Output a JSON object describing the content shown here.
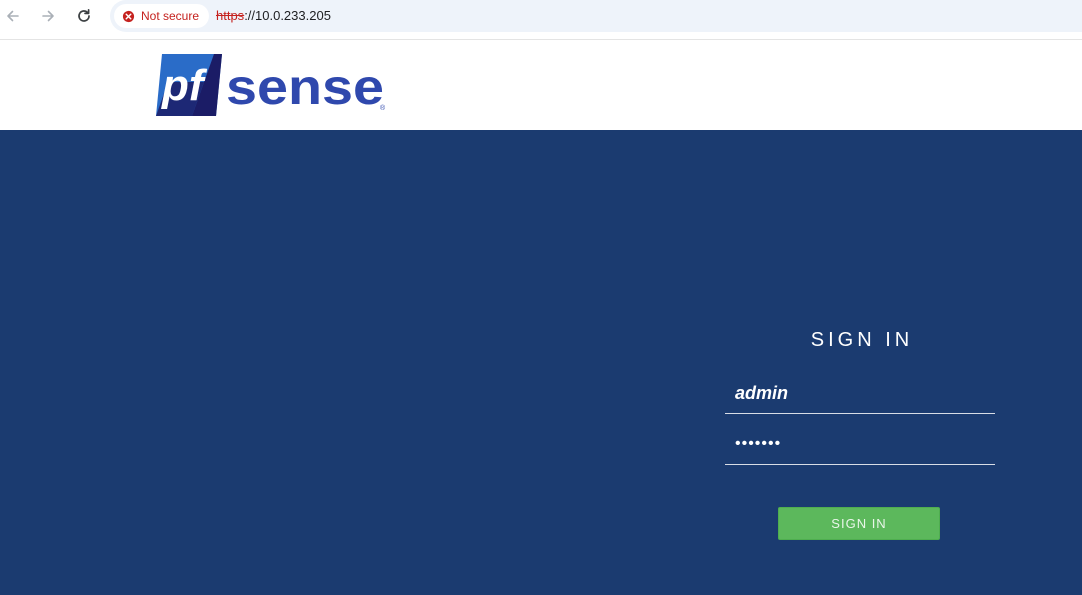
{
  "browser": {
    "security_label": "Not secure",
    "url_scheme": "https",
    "url_rest": "://10.0.233.205"
  },
  "logo": {
    "text_pf": "pf",
    "text_sense": "sense",
    "registered": "®",
    "colors": {
      "dark": "#1b1c66",
      "blue": "#2a6cc8",
      "sense": "#2f48ad"
    }
  },
  "login": {
    "title": "SIGN IN",
    "username_value": "admin",
    "password_value": "•••••••",
    "button_label": "SIGN IN"
  },
  "colors": {
    "background": "#1b3b70",
    "button": "#5cb85c",
    "not_secure": "#c5221f"
  }
}
